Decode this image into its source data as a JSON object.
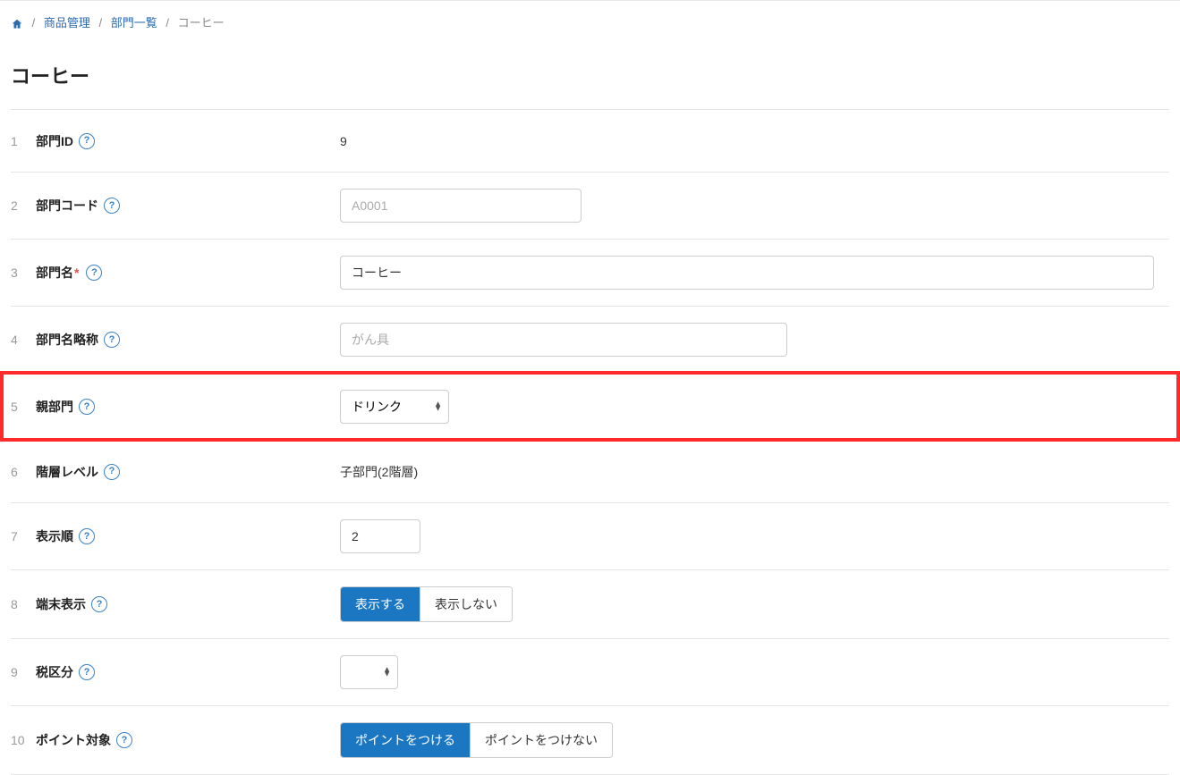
{
  "breadcrumb": {
    "home_label": "ホーム",
    "items": [
      {
        "label": "商品管理"
      },
      {
        "label": "部門一覧"
      }
    ],
    "current": "コーヒー"
  },
  "page_title": "コーヒー",
  "rows": {
    "r1": {
      "num": "1",
      "label": "部門ID",
      "value": "9"
    },
    "r2": {
      "num": "2",
      "label": "部門コード",
      "placeholder": "A0001",
      "value": ""
    },
    "r3": {
      "num": "3",
      "label": "部門名",
      "value": "コーヒー"
    },
    "r4": {
      "num": "4",
      "label": "部門名略称",
      "placeholder": "がん具",
      "value": ""
    },
    "r5": {
      "num": "5",
      "label": "親部門",
      "selected": "ドリンク"
    },
    "r6": {
      "num": "6",
      "label": "階層レベル",
      "value": "子部門(2階層)"
    },
    "r7": {
      "num": "7",
      "label": "表示順",
      "value": "2"
    },
    "r8": {
      "num": "8",
      "label": "端末表示",
      "opt_on": "表示する",
      "opt_off": "表示しない"
    },
    "r9": {
      "num": "9",
      "label": "税区分",
      "selected": ""
    },
    "r10": {
      "num": "10",
      "label": "ポイント対象",
      "opt_on": "ポイントをつける",
      "opt_off": "ポイントをつけない"
    }
  },
  "required_mark": "*",
  "help_glyph": "?"
}
